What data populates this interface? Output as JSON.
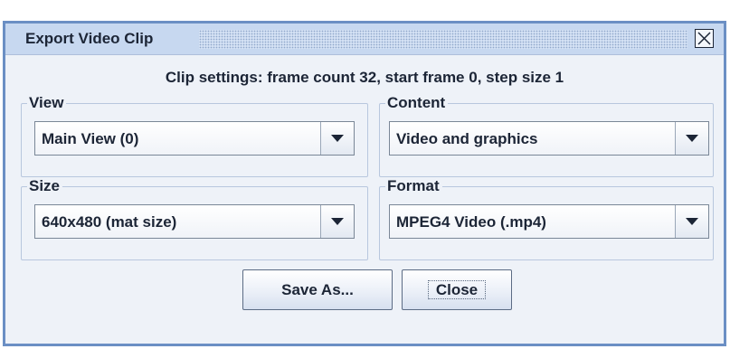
{
  "window": {
    "title": "Export Video Clip",
    "close_icon": "close-icon"
  },
  "summary": "Clip settings: frame count 32, start frame 0, step size 1",
  "groups": {
    "view": {
      "label": "View",
      "selected": "Main View (0)"
    },
    "content": {
      "label": "Content",
      "selected": "Video and graphics"
    },
    "size": {
      "label": "Size",
      "selected": "640x480 (mat size)"
    },
    "format": {
      "label": "Format",
      "selected": "MPEG4 Video (.mp4)"
    }
  },
  "buttons": {
    "save_as": "Save As...",
    "close": "Close"
  },
  "colors": {
    "window_border": "#6b8fc4",
    "titlebar": "#c7d8f0",
    "background": "#eef2f8"
  }
}
